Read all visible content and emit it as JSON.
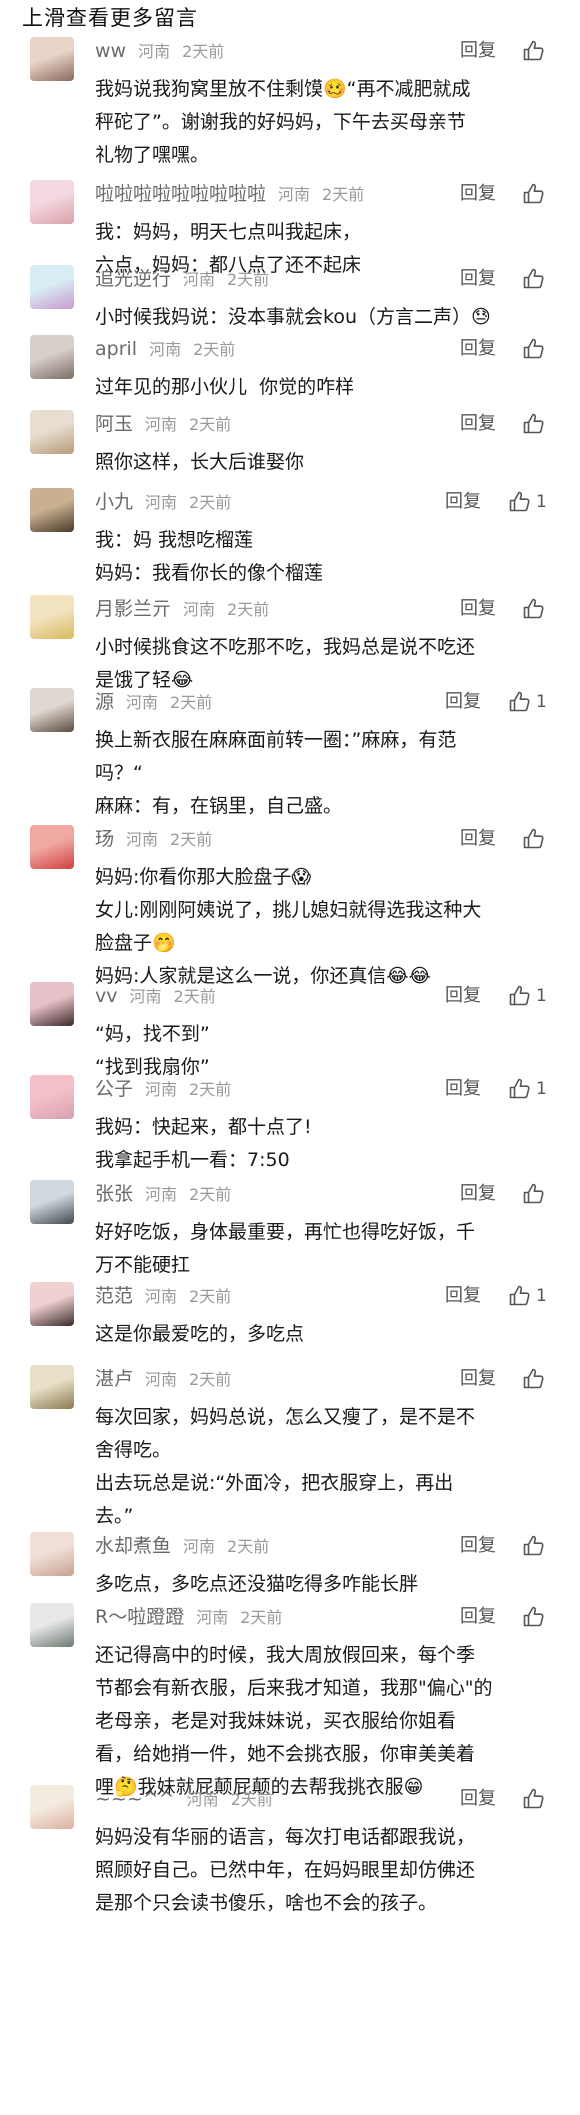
{
  "header": {
    "title": "上滑查看更多留言"
  },
  "reply_label": "回复",
  "comments": [
    {
      "nickname": "ww",
      "location": "河南",
      "time": "2天前",
      "likes": "",
      "lines": [
        "我妈说我狗窝里放不住剩馍🥴“再不减肥就成",
        "秤砣了”。谢谢我的好妈妈，下午去买母亲节",
        "礼物了嘿嘿。"
      ]
    },
    {
      "nickname": "啦啦啦啦啦啦啦啦啦",
      "location": "河南",
      "time": "2天前",
      "likes": "",
      "lines": [
        "我：妈妈，明天七点叫我起床，",
        "六点，妈妈：都八点了还不起床"
      ]
    },
    {
      "nickname": "追光逆行",
      "location": "河南",
      "time": "2天前",
      "likes": "",
      "lines": [
        "小时候我妈说：没本事就会kou（方言二声）😓"
      ]
    },
    {
      "nickname": "april",
      "location": "河南",
      "time": "2天前",
      "likes": "",
      "lines": [
        "过年见的那小伙儿  你觉的咋样"
      ]
    },
    {
      "nickname": "阿玉",
      "location": "河南",
      "time": "2天前",
      "likes": "",
      "lines": [
        "照你这样，长大后谁娶你"
      ]
    },
    {
      "nickname": "小九",
      "location": "河南",
      "time": "2天前",
      "likes": "1",
      "lines": [
        "我：妈 我想吃榴莲",
        "妈妈：我看你长的像个榴莲"
      ]
    },
    {
      "nickname": "月影兰亓",
      "location": "河南",
      "time": "2天前",
      "likes": "",
      "lines": [
        "小时候挑食这不吃那不吃，我妈总是说不吃还",
        "是饿了轻😂"
      ]
    },
    {
      "nickname": "源",
      "location": "河南",
      "time": "2天前",
      "likes": "1",
      "lines": [
        "换上新衣服在麻麻面前转一圈：”麻麻，有范",
        "吗？“",
        "麻麻：有，在锅里，自己盛。"
      ]
    },
    {
      "nickname": "玚",
      "location": "河南",
      "time": "2天前",
      "likes": "",
      "lines": [
        "妈妈:你看你那大脸盘子😱",
        "女儿:刚刚阿姨说了，挑儿媳妇就得选我这种大",
        "脸盘子🤭",
        "妈妈:人家就是这么一说，你还真信😂😂"
      ]
    },
    {
      "nickname": "vv",
      "location": "河南",
      "time": "2天前",
      "likes": "1",
      "lines": [
        "“妈，找不到”",
        "“找到我扇你”"
      ]
    },
    {
      "nickname": "公子",
      "location": "河南",
      "time": "2天前",
      "likes": "1",
      "lines": [
        "我妈：快起来，都十点了!",
        "我拿起手机一看：7:50"
      ]
    },
    {
      "nickname": "张张",
      "location": "河南",
      "time": "2天前",
      "likes": "",
      "lines": [
        "好好吃饭，身体最重要，再忙也得吃好饭，千",
        "万不能硬扛"
      ]
    },
    {
      "nickname": "范范",
      "location": "河南",
      "time": "2天前",
      "likes": "1",
      "lines": [
        "这是你最爱吃的，多吃点"
      ]
    },
    {
      "nickname": "湛卢",
      "location": "河南",
      "time": "2天前",
      "likes": "",
      "lines": [
        "每次回家，妈妈总说，怎么又瘦了，是不是不",
        "舍得吃。",
        "出去玩总是说:“外面冷，把衣服穿上，再出",
        "去。”"
      ]
    },
    {
      "nickname": "水却煮鱼",
      "location": "河南",
      "time": "2天前",
      "likes": "",
      "lines": [
        "多吃点，多吃点还没猫吃得多咋能长胖"
      ]
    },
    {
      "nickname": "R～啦蹬蹬",
      "location": "河南",
      "time": "2天前",
      "likes": "",
      "lines": [
        "还记得高中的时候，我大周放假回来，每个季",
        "节都会有新衣服，后来我才知道，我那\"偏心\"的",
        "老母亲，老是对我妹妹说，买衣服给你姐看",
        "看，给她捎一件，她不会挑衣服，你审美美着",
        "哩🤔我妹就屁颠屁颠的去帮我挑衣服😁"
      ]
    },
    {
      "nickname": "~~~^^",
      "location": "河南",
      "time": "2天前",
      "likes": "",
      "lines": [
        "妈妈没有华丽的语言，每次打电话都跟我说，",
        "照顾好自己。已然中年，在妈妈眼里却仿佛还",
        "是那个只会读书傻乐，啥也不会的孩子。"
      ]
    }
  ],
  "colors": {
    "text": "#1a1a1a",
    "nickname": "#6a6a6a",
    "meta": "#9a9a9a",
    "action": "#555555"
  },
  "icons": {
    "like": "thumbs-up-icon",
    "avatar": "avatar-image"
  }
}
